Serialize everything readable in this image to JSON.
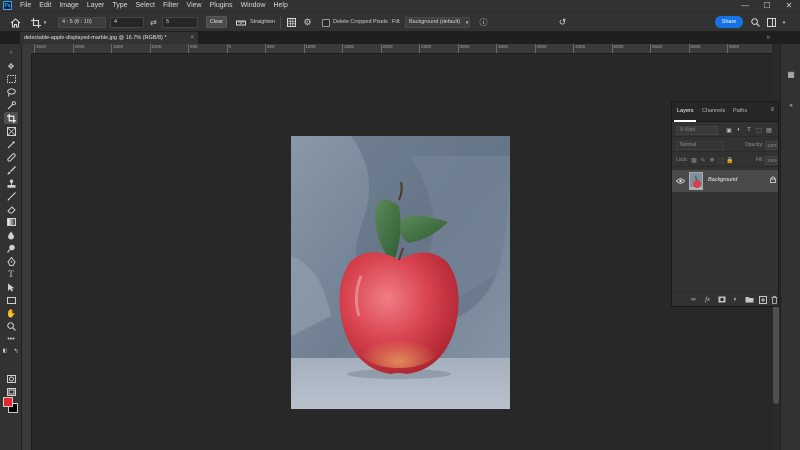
{
  "app": {
    "logo": "Ps"
  },
  "menu": [
    "File",
    "Edit",
    "Image",
    "Layer",
    "Type",
    "Select",
    "Filter",
    "View",
    "Plugins",
    "Window",
    "Help"
  ],
  "window_controls": {
    "minimize": "—",
    "maximize": "☐",
    "close": "✕"
  },
  "options_bar": {
    "ratio_value": "4 : 5 (8 : 10)",
    "width_value": "4",
    "swap_icon": "⇄",
    "height_value": "5",
    "clear_label": "Clear",
    "straighten_label": "Straighten",
    "delete_cropped_label": "Delete Cropped Pixels",
    "fill_label": "Fill:",
    "fill_value": "Background (default)",
    "share_label": "Share"
  },
  "document_tab": {
    "title": "delectable-apple-displayed-marble.jpg @ 16.7% (RGB/8) *",
    "close": "×",
    "overflow_arrows": "»"
  },
  "ruler_labels": [
    "2500",
    "2000",
    "1500",
    "1000",
    "500",
    "0",
    "500",
    "1000",
    "1500",
    "2000",
    "2500",
    "3000",
    "3500",
    "4000",
    "4500",
    "5000",
    "5500",
    "6000",
    "6500"
  ],
  "layers_panel": {
    "tabs": [
      "Layers",
      "Channels",
      "Paths"
    ],
    "menu_icon": "≡",
    "kind_placeholder": "Kind",
    "blend_mode": "Normal",
    "opacity_label": "Opacity:",
    "opacity_value": "100%",
    "lock_label": "Lock:",
    "fill_label": "Fill:",
    "fill_value": "100%",
    "layer": {
      "name": "Background",
      "visible_icon": "👁",
      "lock_icon": "🔒"
    },
    "footer_icons": [
      "link-icon",
      "fx-icon",
      "mask-icon",
      "adjustment-icon",
      "folder-icon",
      "new-layer-icon",
      "trash-icon"
    ]
  },
  "colors": {
    "foreground": "#e3272a",
    "background": "#000000",
    "accent": "#1473e6"
  }
}
